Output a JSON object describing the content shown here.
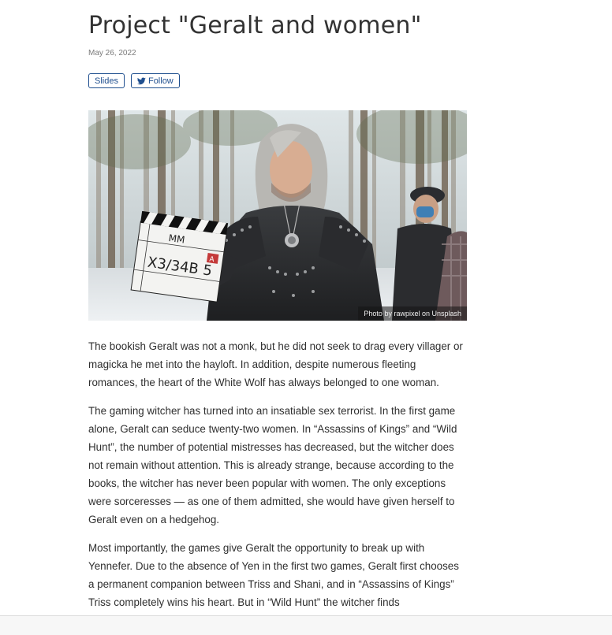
{
  "article": {
    "title": "Project \"Geralt and women\"",
    "date": "May 26, 2022",
    "buttons": {
      "slides_label": "Slides",
      "follow_label": "Follow"
    },
    "image": {
      "credit": "Photo by rawpixel on Unsplash",
      "clapper_text": [
        "MM",
        "X3/34B 5",
        "A"
      ]
    },
    "paragraphs": [
      "The bookish Geralt was not a monk, but he did not seek to drag every villager or magicka he met into the hayloft. In addition, despite numerous fleeting romances, the heart of the White Wolf has always belonged to one woman.",
      "The gaming witcher has turned into an insatiable sex terrorist. In the first game alone, Geralt can seduce twenty-two women. In “Assassins of Kings” and “Wild Hunt”, the number of potential mistresses has decreased, but the witcher does not remain without attention. This is already strange, because according to the books, the witcher has never been popular with women. The only exceptions were sorceresses — as one of them admitted, she would have given herself to Geralt even on a hedgehog.",
      "Most importantly, the games give Geralt the opportunity to break up with Yennefer. Due to the absence of Yen in the first two games, Geralt first chooses a permanent companion between Triss and Shani, and in “Assassins of Kings” Triss completely wins his heart. But in “Wild Hunt” the witcher finds"
    ]
  },
  "icons": {
    "follow": "twitter-bird-icon"
  },
  "colors": {
    "accent": "#1f4f8f",
    "text": "#2f2f2f",
    "date": "#7a7a7a"
  }
}
